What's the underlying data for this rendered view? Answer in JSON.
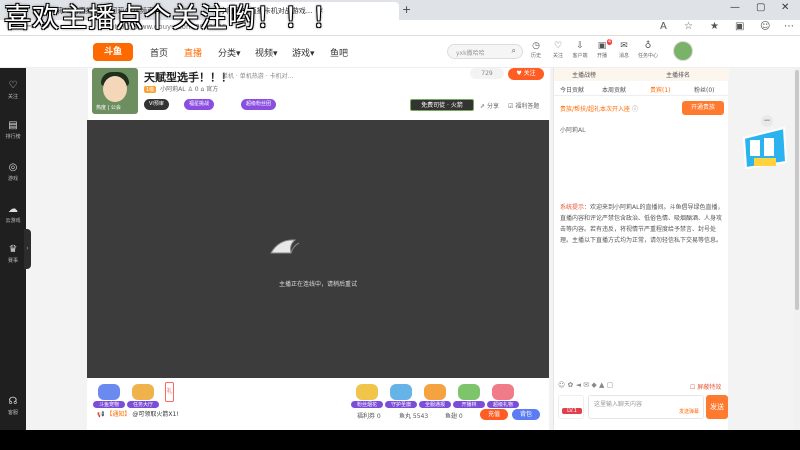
{
  "overlay_title": "喜欢主播点个关注哟！！！",
  "browser": {
    "tabs": [
      {
        "label": "小阿莉AL的直播间_小阿莉AL视频直播..."
      },
      {
        "label": "小阿莉AL直播卡机对战游戏..."
      }
    ],
    "url": "https://www.douyu.com/9073198"
  },
  "header": {
    "logo_text": "斗鱼",
    "nav": [
      {
        "label": "首页"
      },
      {
        "label": "直播"
      },
      {
        "label": "分类"
      },
      {
        "label": "视频"
      },
      {
        "label": "游戏"
      },
      {
        "label": "鱼吧"
      }
    ],
    "search_placeholder": "yxk撒哈哈",
    "actions": [
      {
        "label": "历史"
      },
      {
        "label": "关注"
      },
      {
        "label": "客户端"
      },
      {
        "label": "开播"
      },
      {
        "label": "消息"
      },
      {
        "label": "任务中心"
      }
    ],
    "message_badge": "4"
  },
  "left_sidebar": [
    {
      "label": "关注",
      "icon": "heart-icon"
    },
    {
      "label": "排行榜",
      "icon": "ranking-icon"
    },
    {
      "label": "游戏",
      "icon": "gamepad-icon"
    },
    {
      "label": "云游戏",
      "icon": "cloud-game-icon"
    },
    {
      "label": "赛事",
      "icon": "trophy-icon"
    },
    {
      "label": "客服",
      "icon": "headset-icon"
    }
  ],
  "room": {
    "title": "天赋型选手！！！",
    "breadcrumb": "单机 · 单机热游 · 卡机对...",
    "anchor_name": "小阿莉AL",
    "level": "1级",
    "follow_count": "0",
    "location": "官方",
    "avatar_tags": "热度    | 公会",
    "hot_count": "729",
    "follow_label": "关注",
    "pills": [
      {
        "label": "VI预审"
      },
      {
        "label": "福星挑战"
      },
      {
        "label": "超级粉丝团"
      }
    ],
    "free_gift": "免费司徒 · 火箭",
    "share": "分享",
    "report": "福利答题"
  },
  "video": {
    "message": "主播正在连线中，请稍后重试"
  },
  "gift_bar": {
    "activities": [
      {
        "label": "斗鱼宠物",
        "color": "#6b8af0"
      },
      {
        "label": "任务大厅",
        "color": "#f0b24a"
      }
    ],
    "gifts": [
      {
        "label": "粉丝烟花",
        "color": "#f0c54a"
      },
      {
        "label": "守护圣旗",
        "color": "#66b3e8"
      },
      {
        "label": "全服通报",
        "color": "#f4a340"
      },
      {
        "label": "开播林",
        "color": "#7ec46a"
      },
      {
        "label": "超级礼物",
        "color": "#f07c8a"
      }
    ],
    "orange_tab": "礼",
    "notice_tag": "【通知】",
    "notice_text": "@可领取火箭X1!",
    "wallet_items": [
      {
        "label": "福利券 0"
      },
      {
        "label": "鱼丸 5543"
      },
      {
        "label": "鱼翅 0"
      }
    ],
    "charge": "充值",
    "backpack": "背包"
  },
  "right_panel": {
    "top_left": "主播战榜",
    "top_right": "主播排名",
    "tabs": [
      {
        "label": "今日贡献"
      },
      {
        "label": "本周贡献"
      },
      {
        "label": "贵宾(1)"
      },
      {
        "label": "粉丝(0)"
      }
    ],
    "rank_hint_highlight": "贵族/帮扶/超礼本次开入座",
    "open_guard": "开通贵族",
    "rank_user": "小阿莉AL",
    "system_tag": "系统提示：",
    "system_message": "欢迎来到小阿莉AL的直播间。斗鱼倡导绿色直播，直播内容和评论严禁包含政治、低俗色情、吸烟酗酒、人身攻击等内容。若有违反，将视情节严重程度给予禁言、封号处理。主播以下直播方式均为正常，请勿轻信私下交易等信息。",
    "shield_label": "屏蔽特效",
    "chat_placeholder": "这里输入聊天内容",
    "chat_sub": "发送弹幕",
    "level_icon": "LV.1",
    "send": "发送"
  },
  "colors": {
    "brand": "#ff6a00",
    "follow": "#ff5d23",
    "sidebar_bg": "#1f1f1f",
    "video_bg": "#3c3c3c"
  }
}
